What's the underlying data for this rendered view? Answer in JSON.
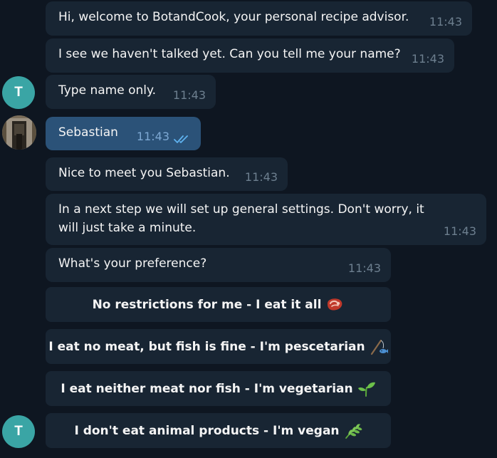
{
  "avatar_letter": "T",
  "messages": [
    {
      "text": "Hi, welcome to BotandCook, your personal recipe advisor.",
      "time": "11:43"
    },
    {
      "text": "I see we haven't talked yet. Can you tell me your name?",
      "time": "11:43"
    },
    {
      "text": "Type name only.",
      "time": "11:43"
    },
    {
      "text": "Sebastian",
      "time": "11:43"
    },
    {
      "text": "Nice to meet you Sebastian.",
      "time": "11:43"
    },
    {
      "text": "In a next step we will set up general settings. Don't worry, it will just take a minute.",
      "time": "11:43"
    },
    {
      "text": "What's your preference?",
      "time": "11:43"
    }
  ],
  "keyboard": [
    {
      "label": "No restrictions for me - I eat it all",
      "icon": "steak-icon"
    },
    {
      "label": "I eat no meat, but fish is fine - I'm pescetarian",
      "icon": "fishing-pole-icon"
    },
    {
      "label": "I eat neither meat nor fish - I'm vegetarian",
      "icon": "seedling-icon"
    },
    {
      "label": "I don't eat animal products - I'm vegan",
      "icon": "herb-icon"
    }
  ],
  "colors": {
    "background": "#0e1621",
    "incoming_bubble": "#182533",
    "outgoing_bubble": "#2b5278",
    "avatar": "#3aa5a5",
    "read_ticks": "#5fb2ef"
  }
}
